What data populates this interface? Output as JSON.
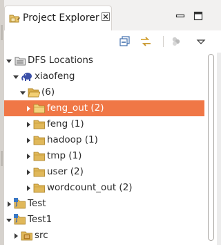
{
  "view": {
    "title": "Project Explorer",
    "tab_icon": "package-explorer-icon",
    "close_icon": "close-icon"
  },
  "window_controls": {
    "minimize_icon": "minimize-icon",
    "maximize_icon": "maximize-icon"
  },
  "toolbar": {
    "collapse_all_icon": "collapse-all-icon",
    "link_with_editor_icon": "link-with-editor-icon",
    "filters_icon": "filter-icon",
    "view_menu_icon": "view-menu-icon"
  },
  "colors": {
    "selection": "#f07746",
    "folder": "#e0b85a",
    "elephant": "#3b50a8"
  },
  "tree": {
    "dfs_locations": "DFS Locations",
    "xiaofeng": "xiaofeng",
    "root_dir": "(6)",
    "feng_out": "feng_out (2)",
    "feng": "feng (1)",
    "hadoop": "hadoop (1)",
    "tmp": "tmp (1)",
    "user": "user (2)",
    "wordcount_out": "wordcount_out (2)",
    "test": "Test",
    "test1": "Test1",
    "src": "src"
  }
}
